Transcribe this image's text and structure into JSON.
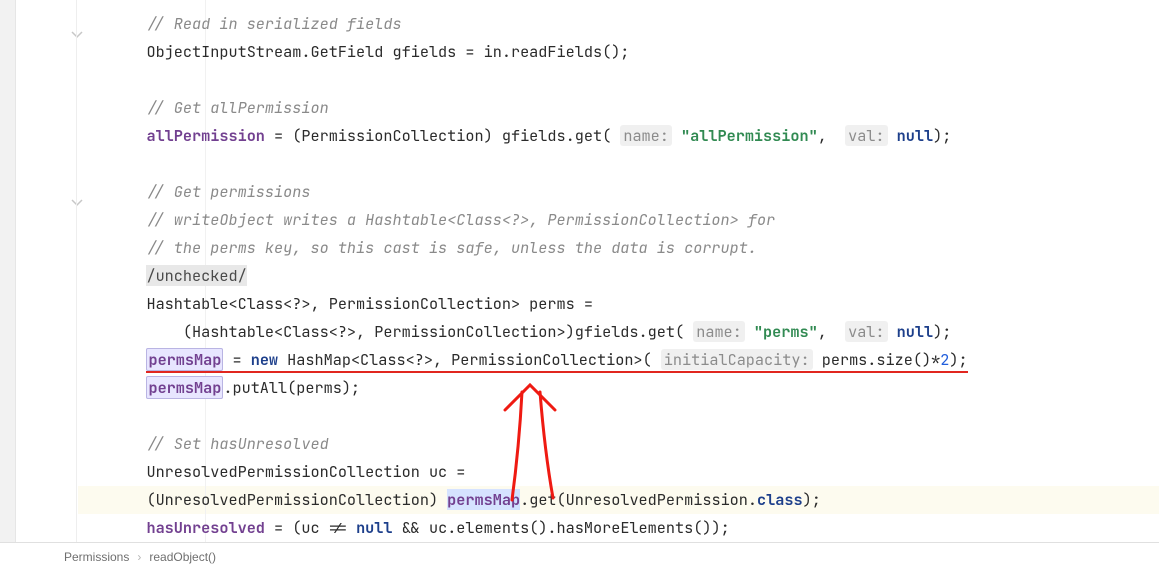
{
  "breadcrumbs": {
    "item1": "Permissions",
    "item2": "readObject()"
  },
  "hints": {
    "name": "name:",
    "val": "val:",
    "initialCapacity": "initialCapacity:"
  },
  "strings": {
    "allPermission": "\"allPermission\"",
    "perms": "\"perms\""
  },
  "nums": {
    "two": "2"
  },
  "code": {
    "c1": "// Read in serialized fields",
    "l2a": "ObjectInputStream.GetField gfields = in.readFields();",
    "c4": "// Get allPermission",
    "l5_field": "allPermission",
    "l5_a": " = (PermissionCollection) gfields.get(",
    "l5_b": ", ",
    "l5_kw": "null",
    "l5_c": ");",
    "c7": "// Get permissions",
    "c8": "// writeObject writes a Hashtable<Class<?>, PermissionCollection> for",
    "c9": "// the perms key, so this cast is safe, unless the data is corrupt.",
    "ann": "/unchecked/",
    "l11": "Hashtable<Class<?>, PermissionCollection> perms =",
    "l12a": "    (Hashtable<Class<?>, PermissionCollection>)gfields.get(",
    "l12b": ", ",
    "l12kw": "null",
    "l12c": ");",
    "l13_pm": "permsMap",
    "l13a": " = ",
    "l13_new": "new",
    "l13b": " HashMap<Class<?>, PermissionCollection>(",
    "l13c": "perms.size()*",
    "l13d": ");",
    "l14_pm": "permsMap",
    "l14a": ".putAll(perms);",
    "c16": "// Set hasUnresolved",
    "l17": "UnresolvedPermissionCollection uc =",
    "l18a": "(UnresolvedPermissionCollection) ",
    "l18_pm1": "permsMa",
    "l18_pm2": "p",
    "l18b": ".get(UnresolvedPermission.",
    "l18_kw": "class",
    "l18c": ");",
    "l19_fld": "hasUnresolved",
    "l19a": " = (uc != ",
    "l19_kw": "null",
    "l19b": " && uc.elements().hasMoreElements());"
  }
}
